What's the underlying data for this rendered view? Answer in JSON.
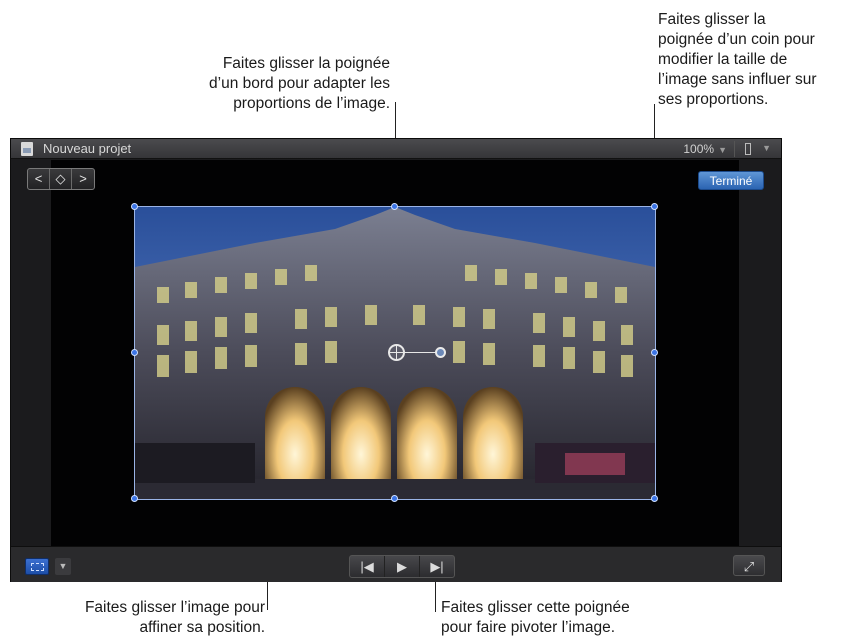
{
  "callouts": {
    "top_center": [
      "Faites glisser la poignée",
      "d’un bord pour adapter les",
      "proportions de l’image."
    ],
    "top_right": [
      "Faites glisser la",
      "poignée d’un coin pour",
      "modifier la taille de",
      "l’image sans influer sur",
      "ses proportions."
    ],
    "bottom_left": [
      "Faites glisser l’image pour",
      "affiner sa position."
    ],
    "bottom_right": [
      "Faites glisser cette poignée",
      "pour faire pivoter l’image."
    ]
  },
  "viewer": {
    "title": "Nouveau projet",
    "zoom": "100%",
    "done_label": "Terminé",
    "nav_icons": [
      "chevron-left-icon",
      "keyframe-icon",
      "chevron-right-icon"
    ],
    "transport_icons": [
      "skip-back-icon",
      "play-icon",
      "skip-forward-icon"
    ],
    "accent": "#3b74e6"
  }
}
